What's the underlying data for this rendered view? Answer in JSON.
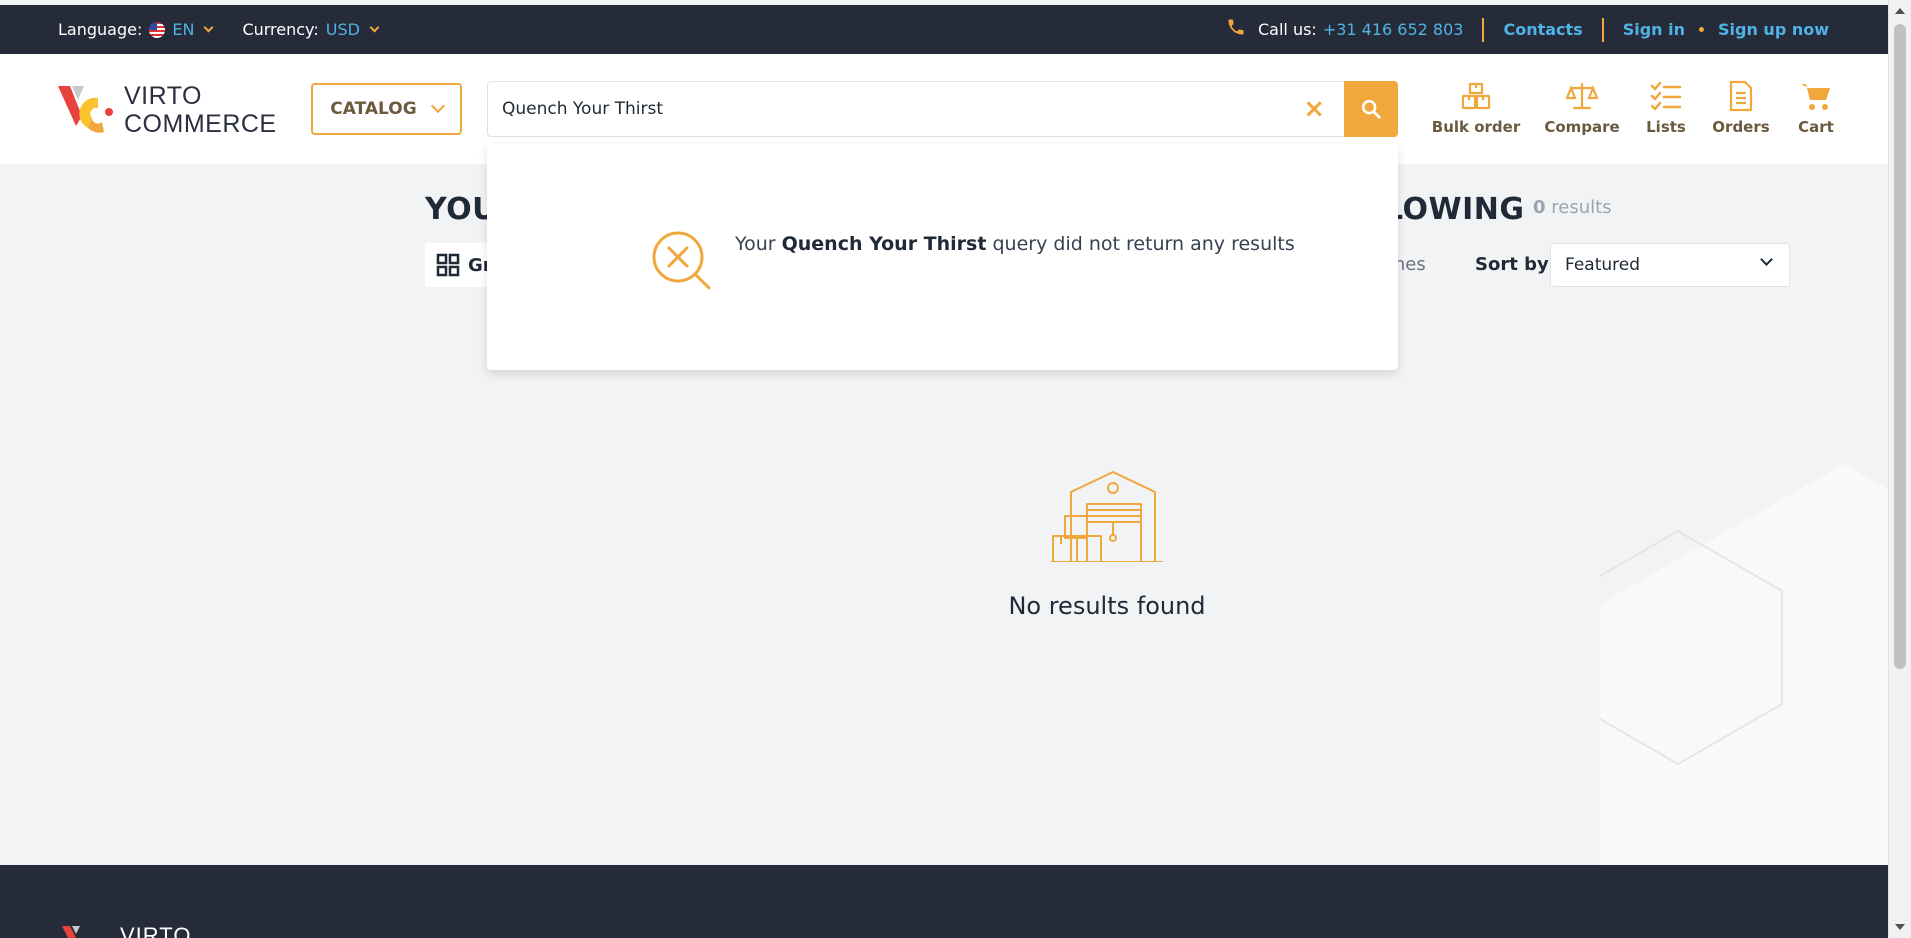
{
  "topbar": {
    "language_label": "Language:",
    "language_value": "EN",
    "currency_label": "Currency:",
    "currency_value": "USD",
    "call_label": "Call us:",
    "phone": "+31 416 652 803",
    "contacts": "Contacts",
    "sign_in": "Sign in",
    "sign_up": "Sign up now"
  },
  "header": {
    "logo_line1": "VIRTO",
    "logo_line2": "COMMERCE",
    "catalog_label": "CATALOG",
    "search_value": "Quench Your Thirst",
    "actions": [
      {
        "label": "Bulk order",
        "icon": "boxes-icon"
      },
      {
        "label": "Compare",
        "icon": "scales-icon"
      },
      {
        "label": "Lists",
        "icon": "checklist-icon"
      },
      {
        "label": "Orders",
        "icon": "document-icon"
      },
      {
        "label": "Cart",
        "icon": "cart-icon"
      }
    ]
  },
  "main": {
    "heading_start": "YOU",
    "heading_end": "LOWING",
    "results_count": "0",
    "results_word": "results",
    "grid_label": "Gr",
    "matches_fragment": "ches",
    "sort_label": "Sort by:",
    "sort_value": "Featured",
    "empty_text": "No results found"
  },
  "dropdown": {
    "prefix": "Your",
    "query": "Quench Your Thirst",
    "suffix": "query did not return any results"
  },
  "footer": {
    "logo_fragment": "VIRTO"
  },
  "colors": {
    "accent": "#f0a83c",
    "link": "#4fb3e6",
    "dark": "#262b3a"
  }
}
